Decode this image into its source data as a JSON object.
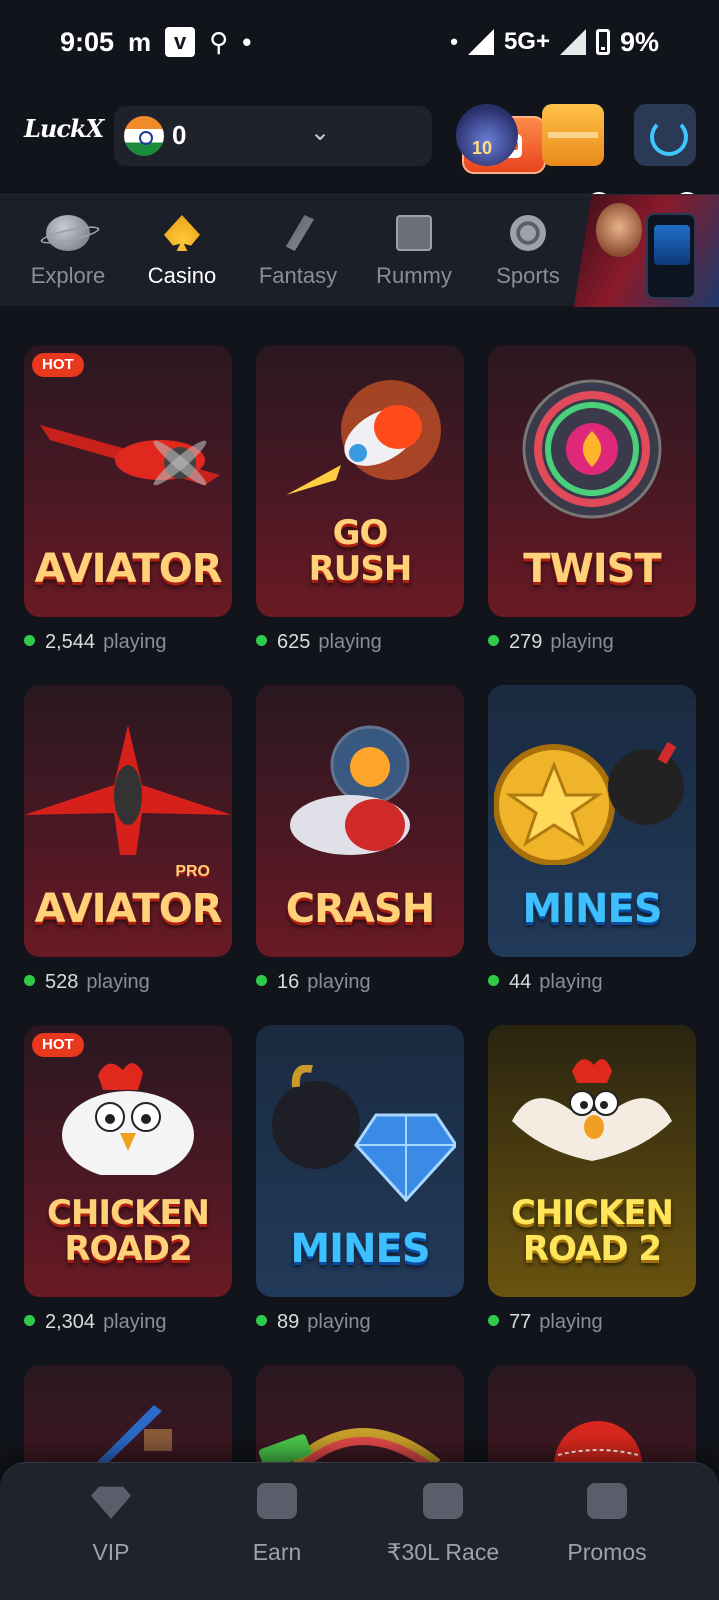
{
  "status_bar": {
    "time": "9:05",
    "left_icons": [
      "m",
      "v",
      "search-icon",
      "•"
    ],
    "network": "5G+",
    "battery": "9%"
  },
  "header": {
    "logo_text": "LuckX",
    "balance": "0",
    "jackpot_level": "10",
    "gift_badge": "1",
    "support_badge": "1"
  },
  "categories": [
    {
      "label": "Explore",
      "icon": "planet-icon",
      "active": false
    },
    {
      "label": "Casino",
      "icon": "spade-icon",
      "active": true
    },
    {
      "label": "Fantasy",
      "icon": "cricket-bat-icon",
      "active": false
    },
    {
      "label": "Rummy",
      "icon": "cards-icon",
      "active": false
    },
    {
      "label": "Sports",
      "icon": "football-icon",
      "active": false
    }
  ],
  "games": [
    {
      "title": "AVIATOR",
      "players": "2,544",
      "playing_label": "playing",
      "hot": true,
      "hot_label": "HOT",
      "theme": "red"
    },
    {
      "title": "GO RUSH",
      "players": "625",
      "playing_label": "playing",
      "hot": false,
      "theme": "red"
    },
    {
      "title": "TWIST",
      "players": "279",
      "playing_label": "playing",
      "hot": false,
      "theme": "red"
    },
    {
      "title": "AVIATOR",
      "subtitle": "PRO",
      "players": "528",
      "playing_label": "playing",
      "hot": false,
      "theme": "red"
    },
    {
      "title": "CRASH",
      "players": "16",
      "playing_label": "playing",
      "hot": false,
      "theme": "red"
    },
    {
      "title": "MINES",
      "players": "44",
      "playing_label": "playing",
      "hot": false,
      "theme": "blue"
    },
    {
      "title": "CHICKEN ROAD2",
      "players": "2,304",
      "playing_label": "playing",
      "hot": true,
      "hot_label": "HOT",
      "theme": "red"
    },
    {
      "title": "MINES",
      "players": "89",
      "playing_label": "playing",
      "hot": false,
      "theme": "blue"
    },
    {
      "title": "CHICKEN ROAD 2",
      "players": "77",
      "playing_label": "playing",
      "hot": false,
      "theme": "gold"
    }
  ],
  "partial_row": [
    {
      "theme": "red"
    },
    {
      "theme": "red"
    },
    {
      "theme": "red"
    }
  ],
  "bottom_nav": [
    {
      "label": "VIP",
      "icon": "diamond-icon"
    },
    {
      "label": "Earn",
      "icon": "rupee-card-icon"
    },
    {
      "label": "₹30L Race",
      "icon": "trophy-icon"
    },
    {
      "label": "Promos",
      "icon": "gift-box-icon"
    }
  ],
  "colors": {
    "background": "#12141b",
    "accent_orange": "#f05a28",
    "online_dot": "#2ecc4a",
    "hot_badge": "#e8381e"
  }
}
